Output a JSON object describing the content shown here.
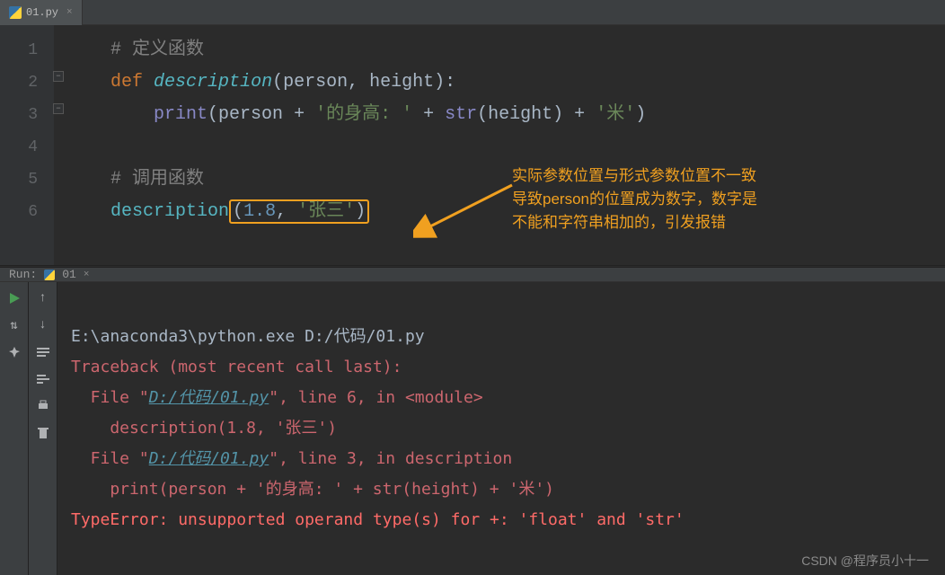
{
  "tab": {
    "filename": "01.py",
    "close": "×"
  },
  "lines": [
    "1",
    "2",
    "3",
    "4",
    "5",
    "6"
  ],
  "code": {
    "comment1": "# 定义函数",
    "kw_def": "def",
    "funcname": "description",
    "params_open": "(",
    "param1": "person",
    "param_sep": ", ",
    "param2": "height",
    "params_close": "):",
    "builtin_print": "print",
    "print_open": "(",
    "var_person": "person",
    "plus": " + ",
    "str1": "'的身高: '",
    "builtin_str": "str",
    "str_open": "(",
    "var_height": "height",
    "str_close": ")",
    "str2": "'米'",
    "print_close": ")",
    "comment2": "# 调用函数",
    "call_name": "description",
    "call_open": "(",
    "arg1": "1.8",
    "arg_sep": ", ",
    "arg2": "'张三'",
    "call_close": ")"
  },
  "annotation": {
    "l1": "实际参数位置与形式参数位置不一致",
    "l2": "导致person的位置成为数字，数字是",
    "l3": "不能和字符串相加的，引发报错"
  },
  "run": {
    "label": "Run:",
    "tab": "01",
    "tab_close": "×"
  },
  "console": {
    "cmd": "E:\\anaconda3\\python.exe D:/代码/01.py",
    "tb1": "Traceback (most recent call last):",
    "file1_pre": "  File \"",
    "file1_link": "D:/代码/01.py",
    "file1_post": "\", line 6, in <module>",
    "code1": "    description(1.8, '张三')",
    "file2_pre": "  File \"",
    "file2_link": "D:/代码/01.py",
    "file2_post": "\", line 3, in description",
    "code2": "    print(person + '的身高: ' + str(height) + '米')",
    "err": "TypeError: unsupported operand type(s) for +: 'float' and 'str'"
  },
  "watermark": "CSDN @程序员小十一"
}
